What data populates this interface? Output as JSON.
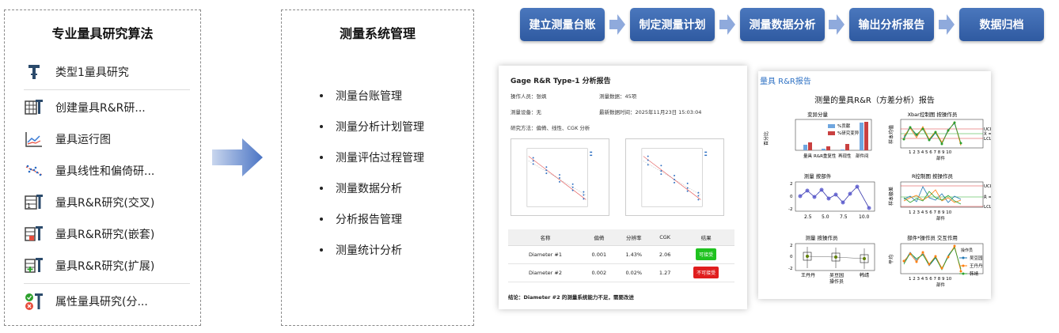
{
  "left": {
    "title": "专业量具研究算法",
    "items": [
      {
        "label": "类型1量具研究",
        "icon": "caliper-icon"
      },
      {
        "label": "创建量具R&R研...",
        "icon": "grid-caliper-icon"
      },
      {
        "label": "量具运行图",
        "icon": "run-chart-icon"
      },
      {
        "label": "量具线性和偏倚研...",
        "icon": "linearity-icon"
      },
      {
        "label": "量具R&R研究(交叉)",
        "icon": "crossed-icon"
      },
      {
        "label": "量具R&R研究(嵌套)",
        "icon": "nested-icon"
      },
      {
        "label": "量具R&R研究(扩展)",
        "icon": "expanded-icon"
      },
      {
        "label": "属性量具研究(分...",
        "icon": "attribute-icon"
      }
    ]
  },
  "middle": {
    "title": "测量系统管理",
    "items": [
      "测量台账管理",
      "测量分析计划管理",
      "测量评估过程管理",
      "测量数据分析",
      "分析报告管理",
      "测量统计分析"
    ]
  },
  "steps": [
    "建立测量台账",
    "制定测量计划",
    "测量数据分析",
    "输出分析报告",
    "数据归档"
  ],
  "report": {
    "title": "Gage R&R Type-1 分析报告",
    "operator": "操作人员：张飒",
    "data_count": "测量数据：45项",
    "device": "测量设备：无",
    "updated": "最新数据时间：2025年11月23日 15:03:04",
    "method": "研究方法：偏倚、线性、CGK 分析",
    "table_headers": [
      "名称",
      "偏倚",
      "分辨率",
      "CGK",
      "结果"
    ],
    "rows": [
      {
        "name": "Diameter #1",
        "bias": "0.001",
        "res": "1.43%",
        "cgk": "2.06",
        "result": "可接受"
      },
      {
        "name": "Diameter #2",
        "bias": "0.002",
        "res": "0.02%",
        "cgk": "1.27",
        "result": "不可接受"
      }
    ],
    "conclusion": "结论：Diameter #2 的测量系统能力不足，需要改进",
    "colors": {
      "ok": "#1fc21f",
      "bad": "#e01e1e"
    }
  },
  "rr": {
    "tag": "量具 R&R报告",
    "title": "测量的量具R&R（方差分析）报告",
    "charts": {
      "variance": {
        "title": "变异分量",
        "ylabel": "百分比",
        "legend": [
          "%贡献",
          "%研究变异"
        ],
        "categories": [
          "量具",
          "R&R重复性",
          "再现性",
          "部件间"
        ]
      },
      "xbar": {
        "title": "Xbar控制图 按操作员",
        "ylabel": "样本均值",
        "xlabel": "部件",
        "limits": [
          "UCL=0.3511",
          "X̄ = 0.0014",
          "LCL=-0.3482"
        ]
      },
      "by_part": {
        "title": "测量 按部件",
        "ticks": [
          "2.5",
          "5.0",
          "7.5",
          "10.0"
        ]
      },
      "r_chart": {
        "title": "R控制图 按操作员",
        "ylabel": "样本极差",
        "xlabel": "部件",
        "limits": [
          "UCL=0.8797",
          "R̄ = 0.3417",
          "LCL=0.0000"
        ]
      },
      "by_operator": {
        "title": "测量 按操作员",
        "xlabel": "操作员",
        "operators": [
          "王丹丹",
          "吴豆园",
          "韩靖"
        ]
      },
      "interaction": {
        "title": "部件*操作员 交互作用",
        "ylabel": "平均",
        "xlabel": "部件",
        "legend_title": "操作员",
        "operators": [
          "吴豆园",
          "王丹丹",
          "韩靖"
        ]
      }
    },
    "series_colors": [
      "#1f77b4",
      "#ff7f0e",
      "#2ca02c"
    ]
  }
}
